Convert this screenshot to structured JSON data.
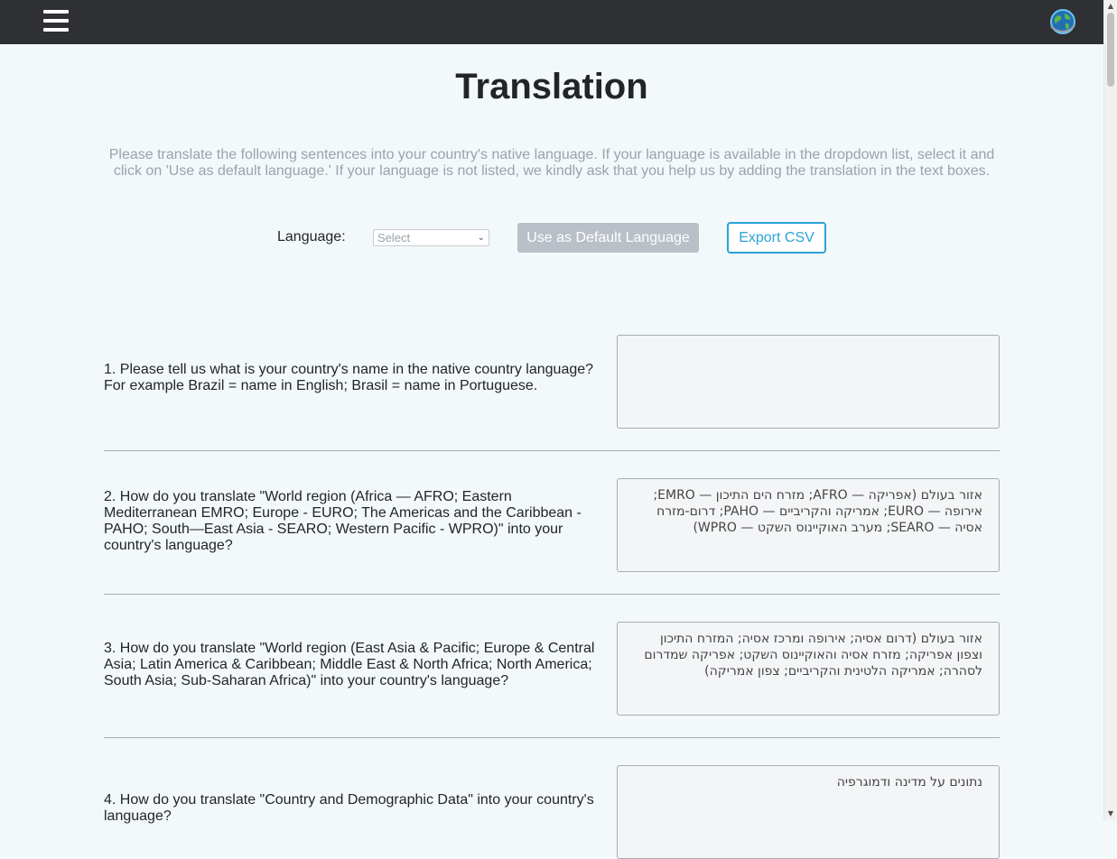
{
  "header": {
    "menu_icon": "hamburger-menu-icon",
    "globe_icon": "globe-icon"
  },
  "page": {
    "title": "Translation",
    "intro": "Please translate the following sentences into your country's native language. If your language is available in the dropdown list, select it and click on 'Use as default language.' If your language is not listed, we kindly ask that you help us by adding the translation in the text boxes."
  },
  "toolbar": {
    "language_label": "Language:",
    "language_selected": "Select",
    "default_button": "Use as Default Language",
    "export_button": "Export CSV"
  },
  "questions": [
    {
      "text": "1. Please tell us what is your country's name in the native country language? For example Brazil = name in English; Brasil = name in Portuguese.",
      "answer": ""
    },
    {
      "text": "2. How do you translate \"World region (Africa — AFRO; Eastern Mediterranean EMRO; Europe - EURO; The Americas and the Caribbean - PAHO; South—East Asia - SEARO; Western Pacific - WPRO)\" into your country's language?",
      "answer": "אזור בעולם (אפריקה — AFRO; מזרח הים התיכון — EMRO; אירופה — EURO; אמריקה והקריביים — PAHO; דרום-מזרח אסיה — SEARO; מערב האוקיינוס השקט — WPRO)"
    },
    {
      "text": "3. How do you translate \"World region (East Asia & Pacific; Europe & Central Asia; Latin America & Caribbean; Middle East & North Africa; North America; South Asia; Sub-Saharan Africa)\" into your country's language?",
      "answer": "אזור בעולם (דרום אסיה; אירופה ומרכז אסיה; המזרח התיכון וצפון אפריקה; מזרח אסיה והאוקיינוס השקט; אפריקה שמדרום לסהרה; אמריקה הלטינית והקריביים; צפון אמריקה)"
    },
    {
      "text": "4. How do you translate \"Country and Demographic Data\" into your country's language?",
      "answer": "נתונים על מדינה ודמוגרפיה"
    }
  ]
}
